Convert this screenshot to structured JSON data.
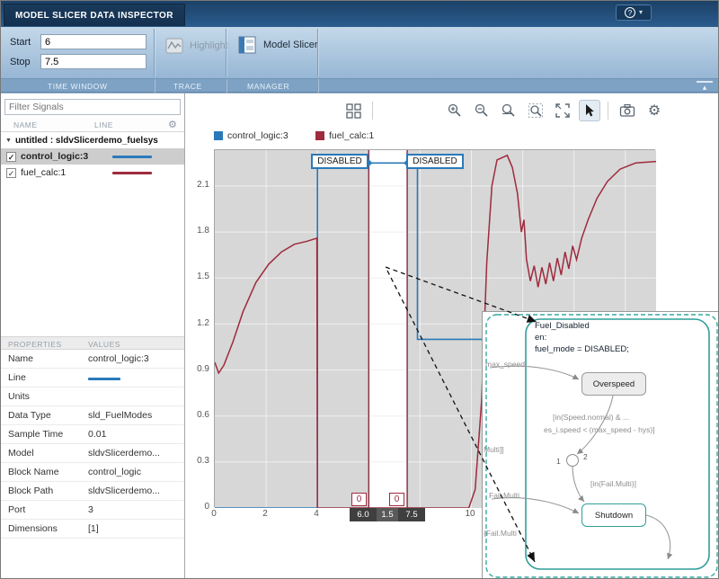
{
  "app": {
    "tab_title": "MODEL SLICER DATA INSPECTOR",
    "help_label": "?"
  },
  "toolstrip": {
    "start_label": "Start",
    "start_value": "6",
    "stop_label": "Stop",
    "stop_value": "7.5",
    "highlight_label": "Highlight",
    "model_slicer_label": "Model Slicer",
    "section_time_window": "TIME WINDOW",
    "section_trace": "TRACE",
    "section_manager": "MANAGER"
  },
  "sidebar": {
    "filter_placeholder": "Filter Signals",
    "col_name": "NAME",
    "col_line": "LINE",
    "tree_root": "untitled : sldvSlicerdemo_fuelsys",
    "signals": [
      {
        "name": "control_logic:3",
        "color": "#2a7ab9"
      },
      {
        "name": "fuel_calc:1",
        "color": "#9e2b3e"
      }
    ],
    "properties_header": {
      "key": "PROPERTIES",
      "value": "VALUES"
    },
    "properties": [
      {
        "key": "Name",
        "value": "control_logic:3"
      },
      {
        "key": "Line",
        "value": ""
      },
      {
        "key": "Units",
        "value": ""
      },
      {
        "key": "Data Type",
        "value": "sld_FuelModes"
      },
      {
        "key": "Sample Time",
        "value": "0.01"
      },
      {
        "key": "Model",
        "value": "sldvSlicerdemo..."
      },
      {
        "key": "Block Name",
        "value": "control_logic"
      },
      {
        "key": "Block Path",
        "value": "sldvSlicerdemo..."
      },
      {
        "key": "Port",
        "value": "3"
      },
      {
        "key": "Dimensions",
        "value": "[1]"
      }
    ]
  },
  "chart": {
    "legend": [
      {
        "label": "control_logic:3",
        "color": "#2a7ab9"
      },
      {
        "label": "fuel_calc:1",
        "color": "#9e2b3e"
      }
    ],
    "callout_left": "DISABLED",
    "callout_right": "DISABLED",
    "cursor_value_left": "0",
    "cursor_value_right": "0",
    "readout_start": "6.0",
    "readout_width": "1.5",
    "readout_end": "7.5",
    "y_ticks": [
      "2.1",
      "1.8",
      "1.5",
      "1.2",
      "0.9",
      "0.6",
      "0.3",
      "0"
    ],
    "x_ticks": [
      "0",
      "2",
      "4",
      "10"
    ]
  },
  "chart_data": {
    "type": "line",
    "x_range": [
      0,
      17.2
    ],
    "y_range": [
      0,
      2.334
    ],
    "time_window": {
      "start": 6.0,
      "end": 7.5,
      "width": 1.5
    },
    "cursor_color": "#8a3548",
    "series": [
      {
        "name": "control_logic:3",
        "color": "#2a7ab9",
        "points": [
          [
            0,
            0
          ],
          [
            4,
            0
          ],
          [
            4,
            2.25
          ],
          [
            7.9,
            2.25
          ],
          [
            7.9,
            1.1
          ],
          [
            17.2,
            1.1
          ]
        ]
      },
      {
        "name": "fuel_calc:1",
        "color": "#9e2b3e",
        "points": [
          [
            0,
            0.95
          ],
          [
            0.15,
            0.88
          ],
          [
            0.35,
            0.93
          ],
          [
            0.7,
            1.08
          ],
          [
            1.1,
            1.28
          ],
          [
            1.6,
            1.47
          ],
          [
            2.1,
            1.59
          ],
          [
            2.6,
            1.67
          ],
          [
            3.1,
            1.72
          ],
          [
            3.6,
            1.74
          ],
          [
            3.98,
            1.76
          ],
          [
            4,
            0
          ],
          [
            9.9,
            0
          ],
          [
            10.15,
            0.12
          ],
          [
            10.4,
            0.7
          ],
          [
            10.6,
            1.6
          ],
          [
            10.8,
            2.1
          ],
          [
            11.0,
            2.27
          ],
          [
            11.4,
            2.3
          ],
          [
            11.6,
            2.22
          ],
          [
            11.8,
            2.05
          ],
          [
            11.95,
            1.8
          ],
          [
            12.05,
            1.88
          ],
          [
            12.15,
            1.62
          ],
          [
            12.3,
            1.48
          ],
          [
            12.45,
            1.58
          ],
          [
            12.6,
            1.44
          ],
          [
            12.75,
            1.57
          ],
          [
            12.9,
            1.46
          ],
          [
            13.05,
            1.6
          ],
          [
            13.2,
            1.48
          ],
          [
            13.35,
            1.63
          ],
          [
            13.5,
            1.52
          ],
          [
            13.65,
            1.67
          ],
          [
            13.8,
            1.56
          ],
          [
            13.95,
            1.71
          ],
          [
            14.1,
            1.62
          ],
          [
            14.3,
            1.76
          ],
          [
            14.55,
            1.88
          ],
          [
            14.9,
            2.02
          ],
          [
            15.3,
            2.13
          ],
          [
            15.8,
            2.21
          ],
          [
            16.4,
            2.25
          ],
          [
            17.2,
            2.26
          ]
        ]
      }
    ],
    "markers": [
      [
        6,
        2.25
      ],
      [
        7.5,
        2.25
      ]
    ]
  },
  "overlay": {
    "state_name": "Fuel_Disabled",
    "state_entry_label": "en:",
    "state_entry_action": "fuel_mode = DISABLED;",
    "substate_overspeed": "Overspeed",
    "substate_shutdown": "Shutdown",
    "cond_speed_1": "[in(Speed.normal) & ...",
    "cond_speed_2": "es_i.speed < (max_speed - hys)]",
    "cond_fail": "[in(Fail.Multi)]",
    "junction_in": "1",
    "junction_out": "2",
    "clipped_max_speed": "max_speed",
    "clipped_multi": "Multi]]",
    "clipped_fail_multi": "Fail.Multi",
    "clipped_fail_multi2": "(Fail.Multi"
  },
  "icons": {
    "gear": "⚙",
    "check": "✓",
    "caret_down": "▾",
    "collapse": "▴",
    "tree_expanded": "▼"
  }
}
